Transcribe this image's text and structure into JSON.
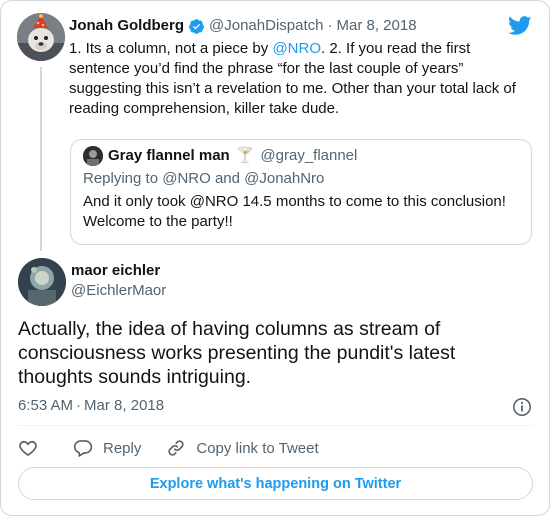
{
  "parent_tweet": {
    "author_name": "Jonah Goldberg",
    "handle": "@JonahDispatch",
    "separator": "·",
    "date": "Mar 8, 2018",
    "text_before_mention": "1. Its a column, not a piece by ",
    "mention": "@NRO",
    "text_after_mention": ". 2. If you read the first sentence you’d find the phrase “for the last couple of years” suggesting this isn’t a revelation to me.  Other than your total lack of reading comprehension, killer take dude."
  },
  "quoted_tweet": {
    "author_name": "Gray flannel man",
    "emoji": "🍸",
    "handle": "@gray_flannel",
    "replying_to": "Replying to @NRO and @JonahNro",
    "text": "And it only took @NRO 14.5 months to come to this conclusion! Welcome to the party!!"
  },
  "main_tweet": {
    "author_name": "maor eichler",
    "handle": "@EichlerMaor",
    "text": "Actually, the idea of having columns as stream of consciousness works presenting the pundit's latest thoughts sounds intriguing.",
    "time": "6:53 AM",
    "separator": "·",
    "date": "Mar 8, 2018"
  },
  "actions": {
    "reply_label": "Reply",
    "copy_link_label": "Copy link to Tweet"
  },
  "footer": {
    "explore_label": "Explore what's happening on Twitter"
  },
  "colors": {
    "accent": "#1d9bf0",
    "text": "#0f1419",
    "secondary_text": "#536471",
    "border": "#cfd9de"
  },
  "icons": {
    "verified": "verified-badge-icon",
    "brand": "twitter-bird-icon",
    "info": "info-icon",
    "like": "heart-icon",
    "reply": "reply-bubble-icon",
    "copy_link": "link-icon"
  }
}
